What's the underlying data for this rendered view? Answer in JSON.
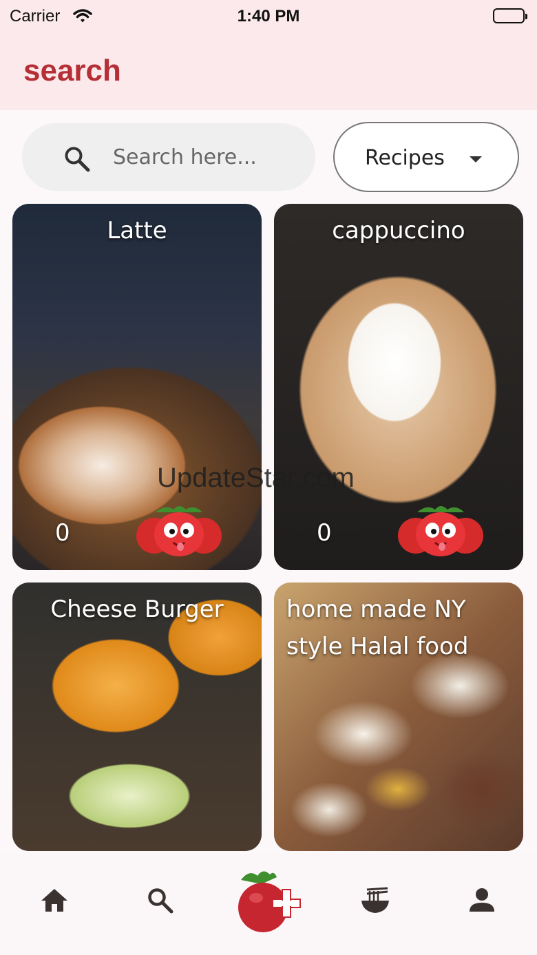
{
  "status_bar": {
    "carrier": "Carrier",
    "time": "1:40 PM"
  },
  "app_bar": {
    "title": "search"
  },
  "search": {
    "placeholder": "Search here..."
  },
  "filter": {
    "selected": "Recipes"
  },
  "cards": [
    {
      "title": "Latte",
      "count": "0"
    },
    {
      "title": "cappuccino",
      "count": "0"
    },
    {
      "title": "Cheese Burger"
    },
    {
      "title": "home made NY style Halal food"
    }
  ],
  "watermark": "UpdateStar.com",
  "icons": {
    "home": "home-icon",
    "search": "search-icon",
    "add": "tomato-add-icon",
    "recipes": "noodle-bowl-icon",
    "profile": "person-icon"
  },
  "colors": {
    "accent": "#b52f35",
    "app_bar_bg": "#fbe9ec",
    "nav_icon": "#3a3230"
  }
}
